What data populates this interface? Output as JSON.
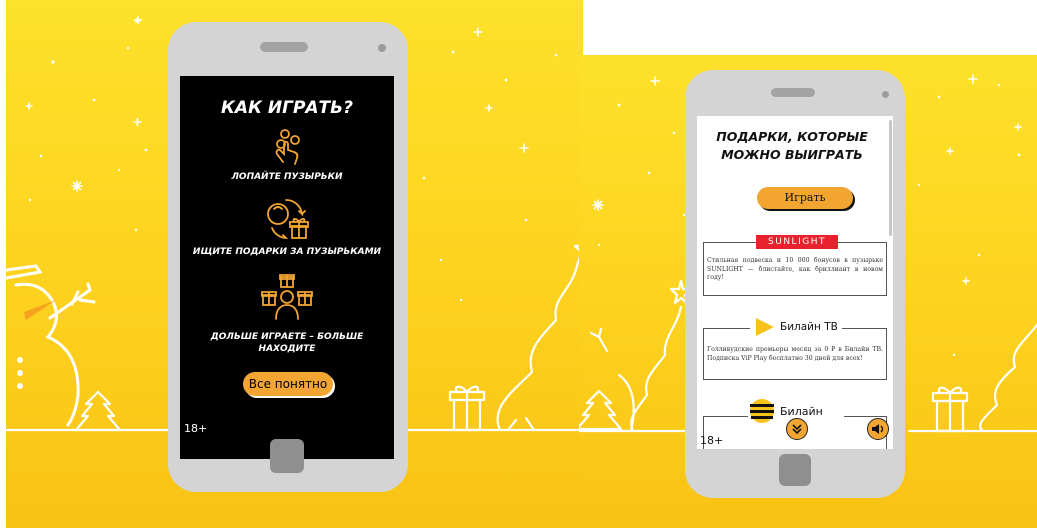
{
  "screens": {
    "left": {
      "title": "КАК ИГРАТЬ?",
      "steps": [
        {
          "label": "ЛОПАЙТЕ ПУЗЫРЬКИ",
          "icon": "tap-bubbles-icon"
        },
        {
          "label": "ИЩИТЕ ПОДАРКИ ЗА ПУЗЫРЬКАМИ",
          "icon": "bubble-gift-icon"
        },
        {
          "label": "ДОЛЬШЕ ИГРАЕТЕ – БОЛЬШЕ НАХОДИТЕ",
          "icon": "person-gifts-icon"
        }
      ],
      "button_label": "Все понятно",
      "age_rating": "18+"
    },
    "right": {
      "title": "ПОДАРКИ, КОТОРЫЕ МОЖНО ВЫИГРАТЬ",
      "play_button_label": "Играть",
      "prizes": [
        {
          "logo": "SUNLIGHT",
          "description": "Стильная подвеска и 10 000 бонусов в пузырьке SUNLIGHT — блистайте, как бриллиант в новом году!"
        },
        {
          "logo": "Билайн ТВ",
          "description": "Голливудские премьеры месяц за 0 ₽ в Билайн ТВ. Подписка ViP Play бесплатно 30 дней для всех!"
        },
        {
          "logo": "Билайн",
          "description": ""
        }
      ],
      "age_rating": "18+",
      "scroll_icon": "chevron-double-down-icon",
      "sound_icon": "speaker-icon"
    }
  },
  "colors": {
    "background": "#fdd21f",
    "accent": "#f2a531",
    "sunlight_red": "#e8222c",
    "phone_body": "#d4d4d4"
  }
}
